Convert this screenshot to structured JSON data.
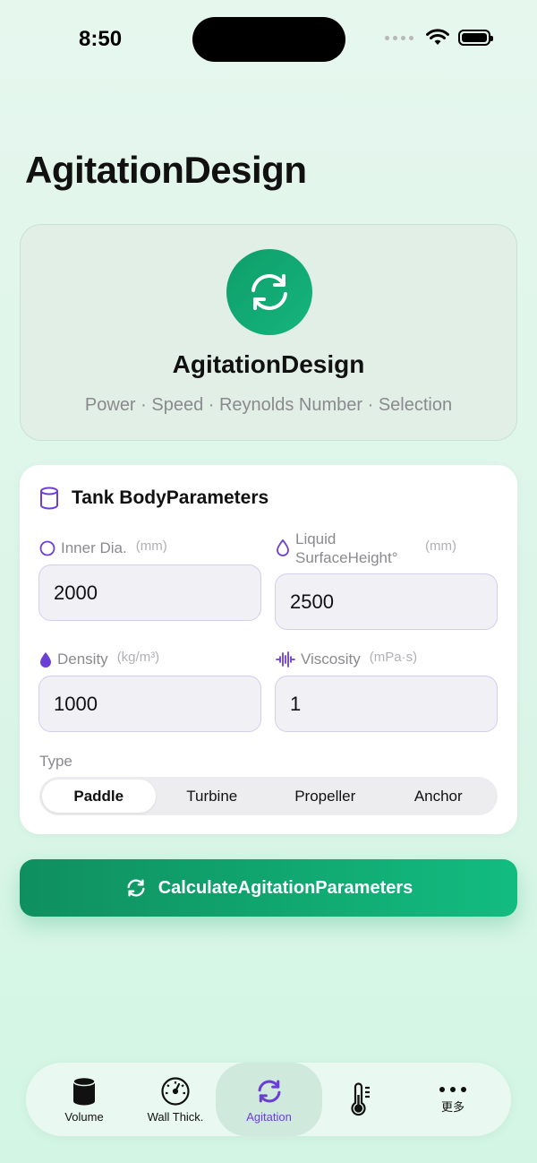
{
  "status": {
    "time": "8:50"
  },
  "page": {
    "title": "AgitationDesign"
  },
  "hero": {
    "title": "AgitationDesign",
    "subtitle": "Power · Speed · Reynolds Number · Selection"
  },
  "tank": {
    "title": "Tank BodyParameters",
    "inner_dia": {
      "label": "Inner Dia.",
      "unit": "(mm)",
      "value": "2000"
    },
    "liquid_height": {
      "label": "Liquid SurfaceHeight°",
      "unit": "(mm)",
      "value": "2500"
    },
    "density": {
      "label": "Density",
      "unit": "(kg/m³)",
      "value": "1000"
    },
    "viscosity": {
      "label": "Viscosity",
      "unit": "(mPa·s)",
      "value": "1"
    },
    "type_label": "Type",
    "types": [
      "Paddle",
      "Turbine",
      "Propeller",
      "Anchor"
    ],
    "selected_type": "Paddle"
  },
  "calculate": {
    "label": "CalculateAgitationParameters"
  },
  "tabbar": {
    "items": [
      {
        "label": "Volume",
        "icon": "cylinder-icon"
      },
      {
        "label": "Wall Thick.",
        "icon": "gauge-icon"
      },
      {
        "label": "Agitation",
        "icon": "rotate-icon"
      },
      {
        "label": "",
        "icon": "thermometer-icon"
      },
      {
        "label": "更多",
        "icon": "ellipsis-icon"
      }
    ],
    "active": "Agitation"
  },
  "colors": {
    "accent": "#12a872",
    "purple": "#6b3fd6",
    "background": "#dff6ea"
  }
}
